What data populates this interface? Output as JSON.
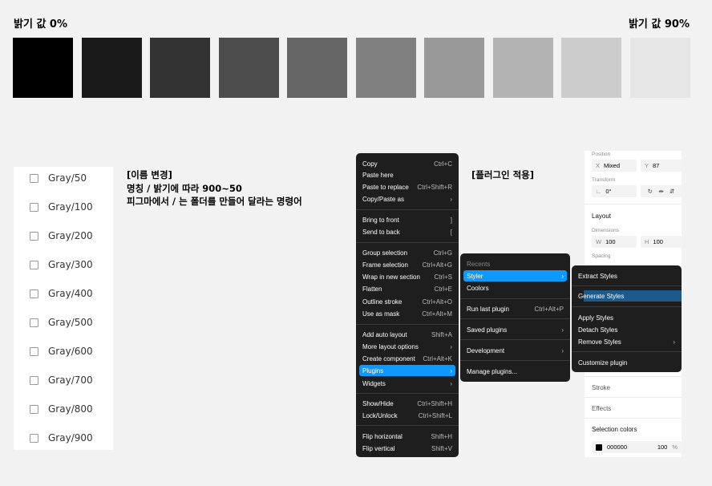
{
  "brightness": {
    "left_label": "밝기 값 0%",
    "right_label": "밝기 값 90%"
  },
  "swatches": [
    "#000000",
    "#1a1a1a",
    "#333333",
    "#4d4d4d",
    "#666666",
    "#808080",
    "#999999",
    "#b3b3b3",
    "#cccccc",
    "#e6e6e6"
  ],
  "gray_list": [
    "Gray/50",
    "Gray/100",
    "Gray/200",
    "Gray/300",
    "Gray/400",
    "Gray/500",
    "Gray/600",
    "Gray/700",
    "Gray/800",
    "Gray/900"
  ],
  "note": {
    "line1": "[이름 변경]",
    "line2": "명칭 / 밝기에 따라 900~50",
    "line3": "피그마에서 / 는 폴더를 만들어 달라는 명령어"
  },
  "plugin_note": "[플러그인 적용]",
  "context_menu": {
    "copy": "Copy",
    "copy_sc": "Ctrl+C",
    "paste_here": "Paste here",
    "paste_replace": "Paste to replace",
    "paste_replace_sc": "Ctrl+Shift+R",
    "copy_paste_as": "Copy/Paste as",
    "bring_front": "Bring to front",
    "bring_front_sc": "]",
    "send_back": "Send to back",
    "send_back_sc": "[",
    "group_sel": "Group selection",
    "group_sel_sc": "Ctrl+G",
    "frame_sel": "Frame selection",
    "frame_sel_sc": "Ctrl+Alt+G",
    "wrap_section": "Wrap in new section",
    "wrap_section_sc": "Ctrl+S",
    "flatten": "Flatten",
    "flatten_sc": "Ctrl+E",
    "outline": "Outline stroke",
    "outline_sc": "Ctrl+Alt+O",
    "use_mask": "Use as mask",
    "use_mask_sc": "Ctrl+Alt+M",
    "auto_layout": "Add auto layout",
    "auto_layout_sc": "Shift+A",
    "more_layout": "More layout options",
    "create_comp": "Create component",
    "create_comp_sc": "Ctrl+Alt+K",
    "plugins": "Plugins",
    "widgets": "Widgets",
    "show_hide": "Show/Hide",
    "show_hide_sc": "Ctrl+Shift+H",
    "lock": "Lock/Unlock",
    "lock_sc": "Ctrl+Shift+L",
    "flip_h": "Flip horizontal",
    "flip_h_sc": "Shift+H",
    "flip_v": "Flip vertical",
    "flip_v_sc": "Shift+V",
    "arrow": "›"
  },
  "plugins_menu": {
    "recents": "Recents",
    "styler": "Styler",
    "coolors": "Coolors",
    "run_last": "Run last plugin",
    "run_last_sc": "Ctrl+Alt+P",
    "saved": "Saved plugins",
    "development": "Development",
    "manage": "Manage plugins..."
  },
  "styler_menu": {
    "extract": "Extract Styles",
    "generate": "Generate Styles",
    "apply": "Apply Styles",
    "detach": "Detach Styles",
    "remove": "Remove Styles",
    "customize": "Customize plugin"
  },
  "props": {
    "position": "Position",
    "x_key": "X",
    "x_val": "Mixed",
    "y_key": "Y",
    "y_val": "87",
    "transform": "Transform",
    "rot_val": "0°",
    "layout": "Layout",
    "dimensions": "Dimensions",
    "w_key": "W",
    "w_val": "100",
    "h_key": "H",
    "h_val": "100",
    "spacing": "Spacing",
    "stroke": "Stroke",
    "effects": "Effects",
    "sel_colors": "Selection colors",
    "color_hex": "000000",
    "color_opacity": "100",
    "pct": "%"
  }
}
